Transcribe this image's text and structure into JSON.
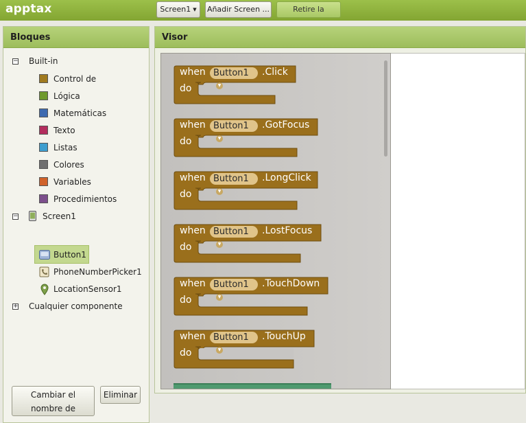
{
  "app": {
    "title": "apptax"
  },
  "toolbar": {
    "screen_label": "Screen1",
    "add_screen_label": "Añadir Screen ...",
    "remove_screen_label": "Retire la pantalla"
  },
  "left_panel": {
    "title": "Bloques",
    "builtin_label": "Built-in",
    "builtin_items": [
      {
        "label": "Control de",
        "color": "#a07a1f"
      },
      {
        "label": "Lógica",
        "color": "#6f9a2e"
      },
      {
        "label": "Matemáticas",
        "color": "#3e6ab0"
      },
      {
        "label": "Texto",
        "color": "#b32d5e"
      },
      {
        "label": "Listas",
        "color": "#3e9ecf"
      },
      {
        "label": "Colores",
        "color": "#6f6f6f"
      },
      {
        "label": "Variables",
        "color": "#d0622a"
      },
      {
        "label": "Procedimientos",
        "color": "#7c4f8c"
      }
    ],
    "screen_label": "Screen1",
    "components": [
      {
        "label": "Button1",
        "icon": "button-icon"
      },
      {
        "label": "PhoneNumberPicker1",
        "icon": "phone-number-picker-icon"
      },
      {
        "label": "LocationSensor1",
        "icon": "location-sensor-icon"
      }
    ],
    "any_component_label": "Cualquier componente",
    "rename_line1": "Cambiar el",
    "rename_line2": "nombre de",
    "delete_label": "Eliminar"
  },
  "viewer": {
    "title": "Visor",
    "block_color": "#9a6f1c",
    "blocks": [
      {
        "when": "when",
        "component": "Button1",
        "event": ".Click",
        "do": "do"
      },
      {
        "when": "when",
        "component": "Button1",
        "event": ".GotFocus",
        "do": "do"
      },
      {
        "when": "when",
        "component": "Button1",
        "event": ".LongClick",
        "do": "do"
      },
      {
        "when": "when",
        "component": "Button1",
        "event": ".LostFocus",
        "do": "do"
      },
      {
        "when": "when",
        "component": "Button1",
        "event": ".TouchDown",
        "do": "do"
      },
      {
        "when": "when",
        "component": "Button1",
        "event": ".TouchUp",
        "do": "do"
      }
    ]
  }
}
